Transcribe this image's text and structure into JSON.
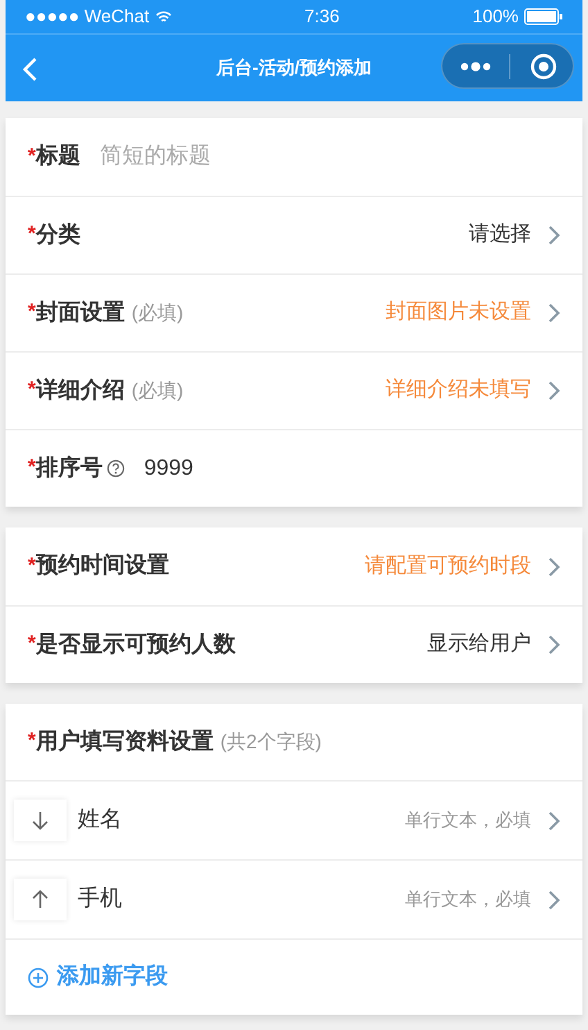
{
  "status_bar": {
    "carrier": "●●●●● WeChat",
    "time": "7:36",
    "battery": "100%"
  },
  "nav": {
    "title": "后台-活动/预约添加"
  },
  "sections": [
    {
      "rows": [
        {
          "kind": "input",
          "asterisk": "*",
          "label": "标题",
          "placeholder": "简短的标题"
        },
        {
          "kind": "select",
          "asterisk": "*",
          "label": "分类",
          "value": "请选择",
          "warning": false
        },
        {
          "kind": "select",
          "asterisk": "*",
          "label": "封面设置",
          "note": "(必填)",
          "value": "封面图片未设置",
          "warning": true
        },
        {
          "kind": "select",
          "asterisk": "*",
          "label": "详细介绍",
          "note": "(必填)",
          "value": "详细介绍未填写",
          "warning": true
        },
        {
          "kind": "input",
          "asterisk": "*",
          "label": "排序号",
          "help": true,
          "value": "9999"
        }
      ]
    },
    {
      "rows": [
        {
          "kind": "select",
          "asterisk": "*",
          "label": "预约时间设置",
          "value": "请配置可预约时段",
          "warning": true
        },
        {
          "kind": "select",
          "asterisk": "*",
          "label": "是否显示可预约人数",
          "value": "显示给用户",
          "warning": false
        }
      ]
    }
  ],
  "user_fields": {
    "asterisk": "*",
    "label": "用户填写资料设置",
    "note": "(共2个字段)",
    "fields": [
      {
        "kind": "down",
        "name": "姓名",
        "detail": "单行文本，必填"
      },
      {
        "kind": "up",
        "name": "手机",
        "detail": "单行文本，必填"
      }
    ],
    "add_label": "添加新字段"
  }
}
